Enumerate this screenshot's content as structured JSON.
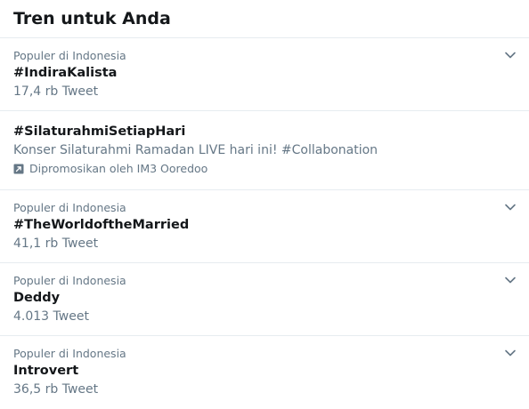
{
  "panel": {
    "title": "Tren untuk Anda"
  },
  "trends": [
    {
      "context": "Populer di Indonesia",
      "title": "#IndiraKalista",
      "count": "17,4 rb Tweet"
    },
    {
      "title": "#SilaturahmiSetiapHari",
      "description": "Konser Silaturahmi Ramadan LIVE hari ini! #Collabonation",
      "promoted": "Dipromosikan oleh IM3 Ooredoo"
    },
    {
      "context": "Populer di Indonesia",
      "title": "#TheWorldoftheMarried",
      "count": "41,1 rb Tweet"
    },
    {
      "context": "Populer di Indonesia",
      "title": "Deddy",
      "count": "4.013 Tweet"
    },
    {
      "context": "Populer di Indonesia",
      "title": "Introvert",
      "count": "36,5 rb Tweet"
    }
  ],
  "colors": {
    "text_primary": "#14171a",
    "text_secondary": "#657786",
    "divider": "#e6ecf0"
  },
  "icons": {
    "chevron": "chevron-down-icon",
    "promoted": "promoted-icon"
  }
}
